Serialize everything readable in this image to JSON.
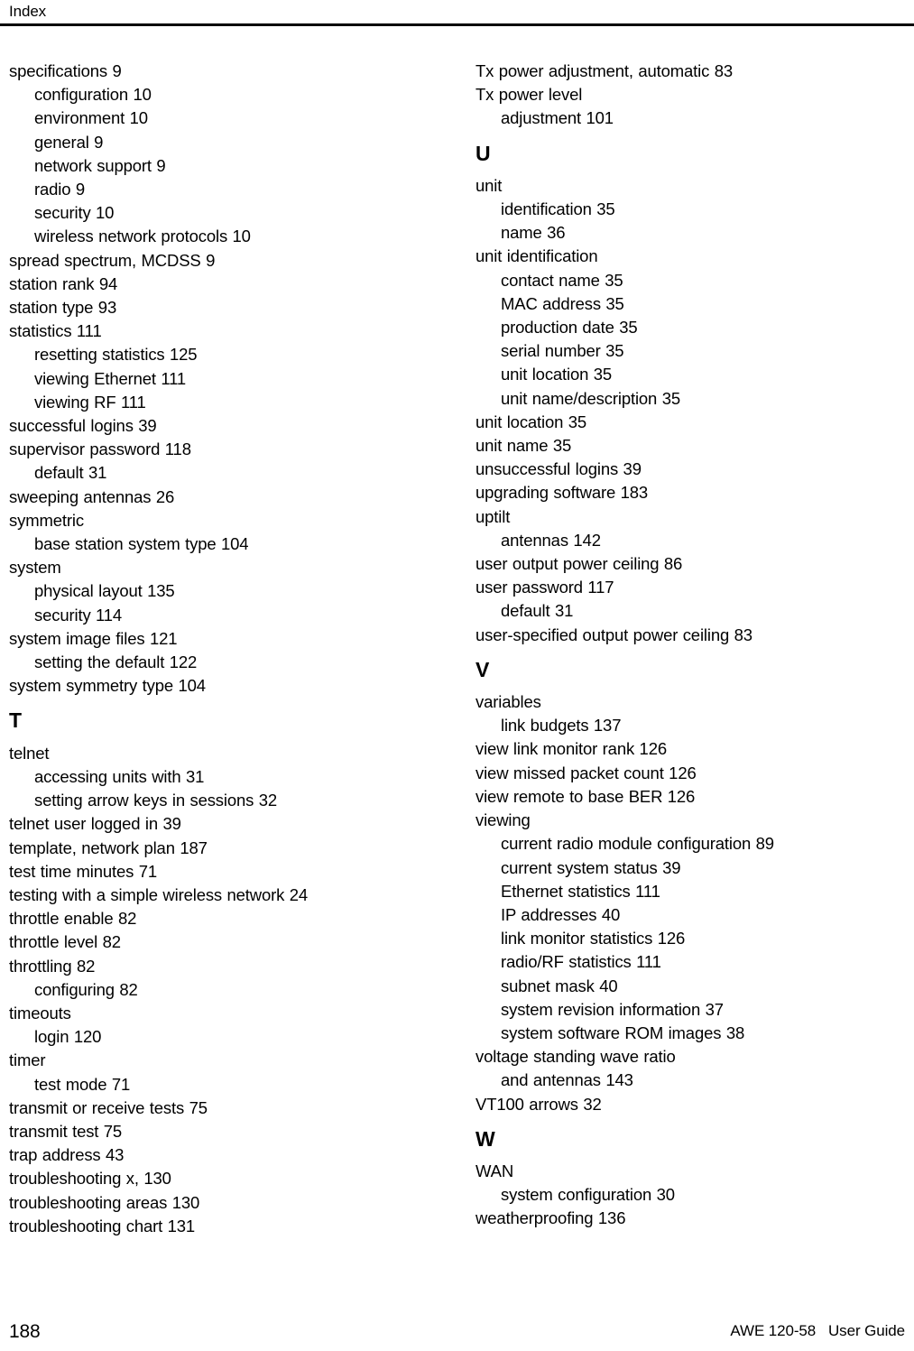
{
  "header": {
    "title": "Index"
  },
  "footer": {
    "page_number": "188",
    "doc_label": "AWE 120-58   User Guide"
  },
  "columns": {
    "left": [
      {
        "type": "entry",
        "level": 1,
        "text": "specifications 9"
      },
      {
        "type": "entry",
        "level": 2,
        "text": "configuration 10"
      },
      {
        "type": "entry",
        "level": 2,
        "text": "environment 10"
      },
      {
        "type": "entry",
        "level": 2,
        "text": "general 9"
      },
      {
        "type": "entry",
        "level": 2,
        "text": "network support 9"
      },
      {
        "type": "entry",
        "level": 2,
        "text": "radio 9"
      },
      {
        "type": "entry",
        "level": 2,
        "text": "security 10"
      },
      {
        "type": "entry",
        "level": 2,
        "text": "wireless network protocols 10"
      },
      {
        "type": "entry",
        "level": 1,
        "text": "spread spectrum, MCDSS 9"
      },
      {
        "type": "entry",
        "level": 1,
        "text": "station rank 94"
      },
      {
        "type": "entry",
        "level": 1,
        "text": "station type 93"
      },
      {
        "type": "entry",
        "level": 1,
        "text": "statistics 111"
      },
      {
        "type": "entry",
        "level": 2,
        "text": "resetting statistics 125"
      },
      {
        "type": "entry",
        "level": 2,
        "text": "viewing Ethernet 111"
      },
      {
        "type": "entry",
        "level": 2,
        "text": "viewing RF 111"
      },
      {
        "type": "entry",
        "level": 1,
        "text": "successful logins 39"
      },
      {
        "type": "entry",
        "level": 1,
        "text": "supervisor password 118"
      },
      {
        "type": "entry",
        "level": 2,
        "text": "default 31"
      },
      {
        "type": "entry",
        "level": 1,
        "text": "sweeping antennas 26"
      },
      {
        "type": "entry",
        "level": 1,
        "text": "symmetric"
      },
      {
        "type": "entry",
        "level": 2,
        "text": "base station system type 104"
      },
      {
        "type": "entry",
        "level": 1,
        "text": "system"
      },
      {
        "type": "entry",
        "level": 2,
        "text": "physical layout 135"
      },
      {
        "type": "entry",
        "level": 2,
        "text": "security 114"
      },
      {
        "type": "entry",
        "level": 1,
        "text": "system image files 121"
      },
      {
        "type": "entry",
        "level": 2,
        "text": "setting the default 122"
      },
      {
        "type": "entry",
        "level": 1,
        "text": "system symmetry type 104"
      },
      {
        "type": "heading",
        "text": "T"
      },
      {
        "type": "entry",
        "level": 1,
        "text": "telnet"
      },
      {
        "type": "entry",
        "level": 2,
        "text": "accessing units with 31"
      },
      {
        "type": "entry",
        "level": 2,
        "text": "setting arrow keys in sessions 32"
      },
      {
        "type": "entry",
        "level": 1,
        "text": "telnet user logged in 39"
      },
      {
        "type": "entry",
        "level": 1,
        "text": "template, network plan 187"
      },
      {
        "type": "entry",
        "level": 1,
        "text": "test time minutes 71"
      },
      {
        "type": "entry",
        "level": 1,
        "text": "testing with a simple wireless network 24"
      },
      {
        "type": "entry",
        "level": 1,
        "text": "throttle enable 82"
      },
      {
        "type": "entry",
        "level": 1,
        "text": "throttle level 82"
      },
      {
        "type": "entry",
        "level": 1,
        "text": "throttling 82"
      },
      {
        "type": "entry",
        "level": 2,
        "text": "configuring 82"
      },
      {
        "type": "entry",
        "level": 1,
        "text": "timeouts"
      },
      {
        "type": "entry",
        "level": 2,
        "text": "login 120"
      },
      {
        "type": "entry",
        "level": 1,
        "text": "timer"
      },
      {
        "type": "entry",
        "level": 2,
        "text": "test mode 71"
      },
      {
        "type": "entry",
        "level": 1,
        "text": "transmit or receive tests 75"
      },
      {
        "type": "entry",
        "level": 1,
        "text": "transmit test 75"
      },
      {
        "type": "entry",
        "level": 1,
        "text": "trap address 43"
      },
      {
        "type": "entry",
        "level": 1,
        "text": "troubleshooting x, 130"
      },
      {
        "type": "entry",
        "level": 1,
        "text": "troubleshooting areas 130"
      },
      {
        "type": "entry",
        "level": 1,
        "text": "troubleshooting chart 131"
      }
    ],
    "right": [
      {
        "type": "entry",
        "level": 1,
        "text": "Tx power adjustment, automatic 83"
      },
      {
        "type": "entry",
        "level": 1,
        "text": "Tx power level"
      },
      {
        "type": "entry",
        "level": 2,
        "text": "adjustment 101"
      },
      {
        "type": "heading",
        "text": "U"
      },
      {
        "type": "entry",
        "level": 1,
        "text": "unit"
      },
      {
        "type": "entry",
        "level": 2,
        "text": "identification 35"
      },
      {
        "type": "entry",
        "level": 2,
        "text": "name 36"
      },
      {
        "type": "entry",
        "level": 1,
        "text": "unit identification"
      },
      {
        "type": "entry",
        "level": 2,
        "text": "contact name 35"
      },
      {
        "type": "entry",
        "level": 2,
        "text": "MAC address 35"
      },
      {
        "type": "entry",
        "level": 2,
        "text": "production date 35"
      },
      {
        "type": "entry",
        "level": 2,
        "text": "serial number 35"
      },
      {
        "type": "entry",
        "level": 2,
        "text": "unit location 35"
      },
      {
        "type": "entry",
        "level": 2,
        "text": "unit name/description 35"
      },
      {
        "type": "entry",
        "level": 1,
        "text": "unit location 35"
      },
      {
        "type": "entry",
        "level": 1,
        "text": "unit name 35"
      },
      {
        "type": "entry",
        "level": 1,
        "text": "unsuccessful logins 39"
      },
      {
        "type": "entry",
        "level": 1,
        "text": "upgrading software 183"
      },
      {
        "type": "entry",
        "level": 1,
        "text": "uptilt"
      },
      {
        "type": "entry",
        "level": 2,
        "text": "antennas 142"
      },
      {
        "type": "entry",
        "level": 1,
        "text": "user output power ceiling 86"
      },
      {
        "type": "entry",
        "level": 1,
        "text": "user password 117"
      },
      {
        "type": "entry",
        "level": 2,
        "text": "default 31"
      },
      {
        "type": "entry",
        "level": 1,
        "text": "user-specified output power ceiling 83"
      },
      {
        "type": "heading",
        "text": "V"
      },
      {
        "type": "entry",
        "level": 1,
        "text": "variables"
      },
      {
        "type": "entry",
        "level": 2,
        "text": "link budgets 137"
      },
      {
        "type": "entry",
        "level": 1,
        "text": "view link monitor rank 126"
      },
      {
        "type": "entry",
        "level": 1,
        "text": "view missed packet count 126"
      },
      {
        "type": "entry",
        "level": 1,
        "text": "view remote to base BER 126"
      },
      {
        "type": "entry",
        "level": 1,
        "text": "viewing"
      },
      {
        "type": "entry",
        "level": 2,
        "text": "current radio module configuration 89"
      },
      {
        "type": "entry",
        "level": 2,
        "text": "current system status 39"
      },
      {
        "type": "entry",
        "level": 2,
        "text": "Ethernet statistics 111"
      },
      {
        "type": "entry",
        "level": 2,
        "text": "IP addresses 40"
      },
      {
        "type": "entry",
        "level": 2,
        "text": "link monitor statistics 126"
      },
      {
        "type": "entry",
        "level": 2,
        "text": "radio/RF statistics 111"
      },
      {
        "type": "entry",
        "level": 2,
        "text": "subnet mask 40"
      },
      {
        "type": "entry",
        "level": 2,
        "text": "system revision information 37"
      },
      {
        "type": "entry",
        "level": 2,
        "text": "system software ROM images 38"
      },
      {
        "type": "entry",
        "level": 1,
        "text": "voltage standing wave ratio"
      },
      {
        "type": "entry",
        "level": 2,
        "text": "and antennas 143"
      },
      {
        "type": "entry",
        "level": 1,
        "text": "VT100 arrows 32"
      },
      {
        "type": "heading",
        "text": "W"
      },
      {
        "type": "entry",
        "level": 1,
        "text": "WAN"
      },
      {
        "type": "entry",
        "level": 2,
        "text": "system configuration 30"
      },
      {
        "type": "entry",
        "level": 1,
        "text": "weatherproofing 136"
      }
    ]
  }
}
